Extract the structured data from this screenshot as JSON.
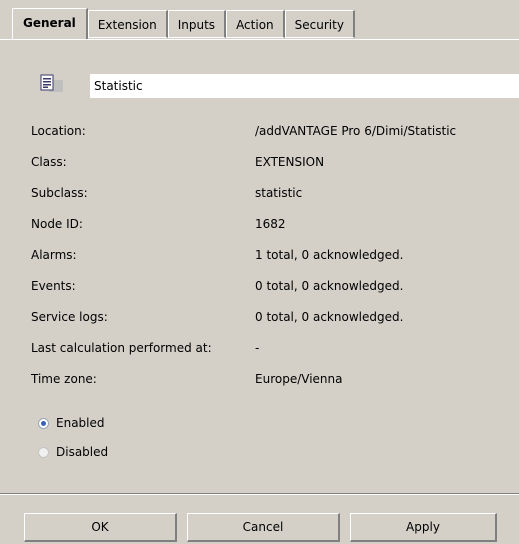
{
  "tabs": [
    {
      "label": "General",
      "active": true
    },
    {
      "label": "Extension",
      "active": false
    },
    {
      "label": "Inputs",
      "active": false
    },
    {
      "label": "Action",
      "active": false
    },
    {
      "label": "Security",
      "active": false
    }
  ],
  "node": {
    "icon": "node-document-icon",
    "name": "Statistic"
  },
  "properties": [
    {
      "label": "Location:",
      "value": "/addVANTAGE Pro 6/Dimi/Statistic"
    },
    {
      "label": "Class:",
      "value": "EXTENSION"
    },
    {
      "label": "Subclass:",
      "value": "statistic"
    },
    {
      "label": "Node ID:",
      "value": "1682"
    },
    {
      "label": "Alarms:",
      "value": "1 total, 0 acknowledged."
    },
    {
      "label": "Events:",
      "value": "0 total, 0 acknowledged."
    },
    {
      "label": "Service logs:",
      "value": "0 total, 0 acknowledged."
    },
    {
      "label": "Last calculation performed at:",
      "value": "-"
    },
    {
      "label": "Time zone:",
      "value": "Europe/Vienna"
    }
  ],
  "state": {
    "options": [
      {
        "label": "Enabled",
        "checked": true
      },
      {
        "label": "Disabled",
        "checked": false
      }
    ]
  },
  "buttons": {
    "ok": "OK",
    "cancel": "Cancel",
    "apply": "Apply"
  }
}
